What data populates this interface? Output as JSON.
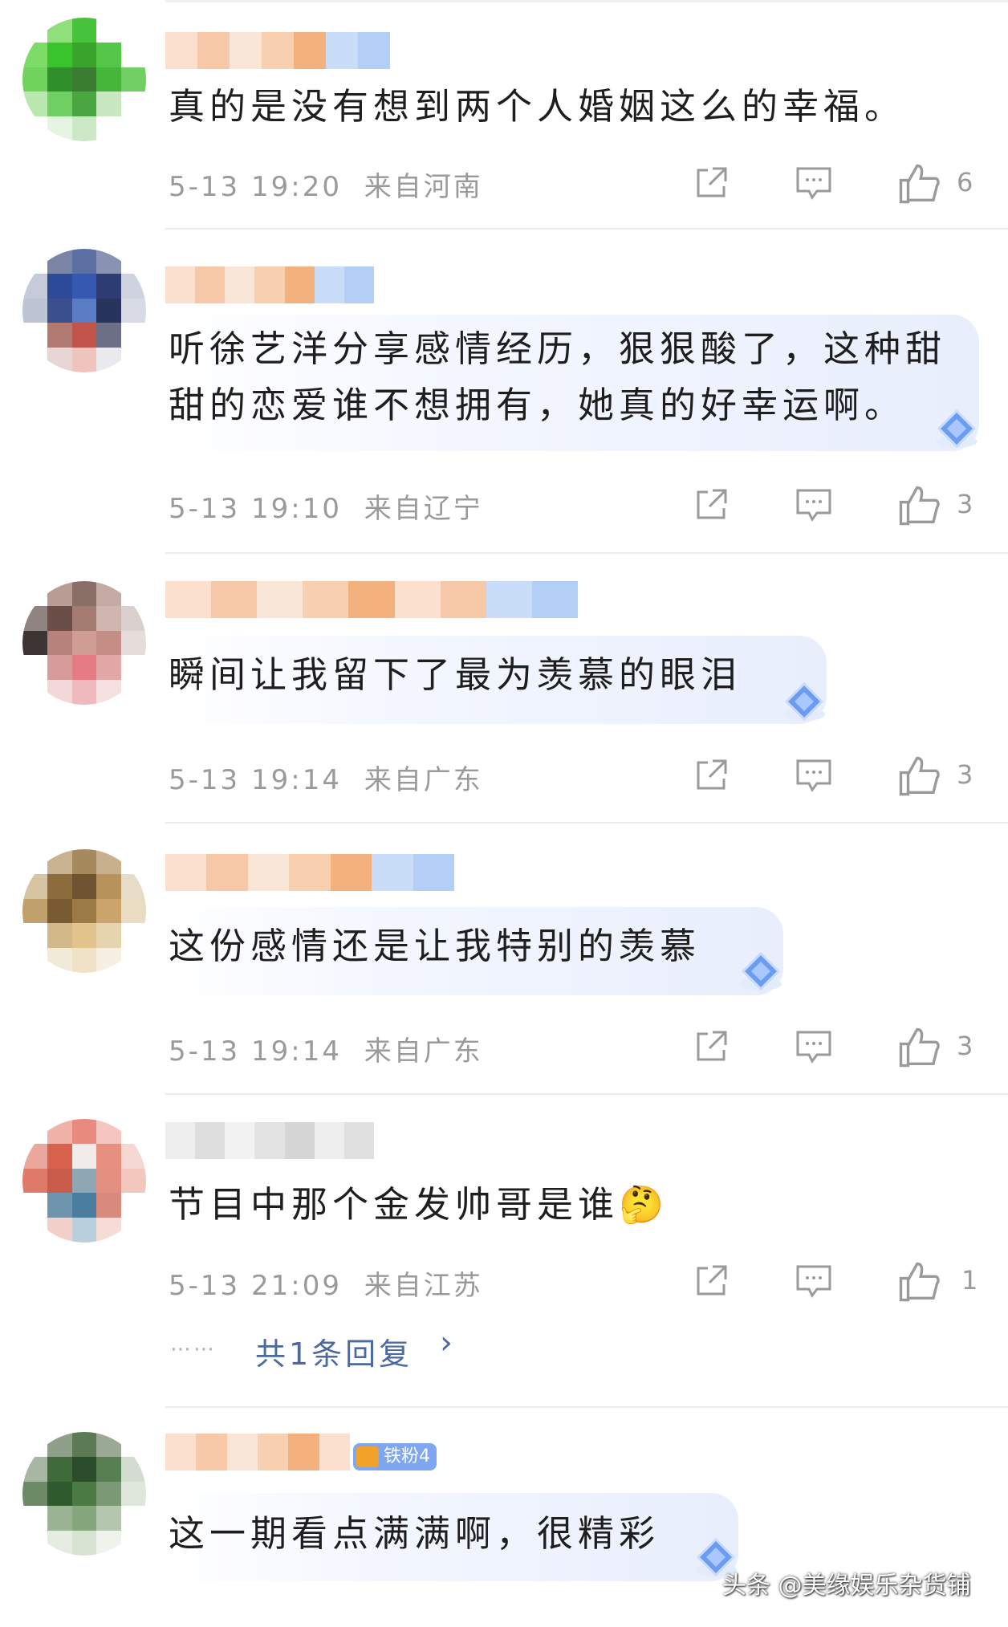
{
  "comments": [
    {
      "text": "真的是没有想到两个人婚姻这么的幸福。",
      "time": "5-13 19:20",
      "location": "来自河南",
      "likes": "6",
      "avatar_colors": [
        "#ffffff",
        "#8fe07a",
        "#47c23b",
        "#ffffff",
        "#ffffff",
        "#7ddb68",
        "#39c42c",
        "#3aa52d",
        "#54c648",
        "#ffffff",
        "#6fd35c",
        "#2f8f2a",
        "#3a7d30",
        "#46b63a",
        "#6fcf62",
        "#b8e8ae",
        "#6fcf62",
        "#4aa640",
        "#c9e8c1",
        "#ffffff",
        "#ffffff",
        "#e6f4e2",
        "#cde8c7",
        "#ffffff",
        "#ffffff"
      ],
      "name_colors": [
        "#fbe0cf",
        "#f6c8a8",
        "#fae6d6",
        "#f8d0b0",
        "#f3b17d",
        "#c9ddf8",
        "#b3cff5"
      ]
    },
    {
      "text": "听徐艺洋分享感情经历，狠狠酸了，这种甜甜的恋爱谁不想拥有，她真的好幸运啊。",
      "time": "5-13 19:10",
      "location": "来自辽宁",
      "likes": "3",
      "avatar_colors": [
        "#ffffff",
        "#7a84a6",
        "#5c6fa3",
        "#8892b3",
        "#ffffff",
        "#c7cad8",
        "#2e4a9a",
        "#3558b0",
        "#2d3d74",
        "#cfd3e0",
        "#bfc4d4",
        "#3b4f8f",
        "#5a7cc4",
        "#27345e",
        "#d8dbe6",
        "#ffffff",
        "#b07a72",
        "#c0534a",
        "#6d6f86",
        "#ffffff",
        "#ffffff",
        "#e8d6d4",
        "#efc4bf",
        "#e9e9ee",
        "#ffffff"
      ],
      "name_colors": [
        "#fbe0cf",
        "#f6c8a8",
        "#fae6d6",
        "#f8d0b0",
        "#f3b17d",
        "#c9ddf8",
        "#b3cff5"
      ]
    },
    {
      "text": "瞬间让我留下了最为羡慕的眼泪",
      "time": "5-13 19:14",
      "location": "来自广东",
      "likes": "3",
      "avatar_colors": [
        "#ffffff",
        "#b99d94",
        "#8a6f67",
        "#c3aaa3",
        "#ffffff",
        "#8f8480",
        "#6b4e47",
        "#a57c72",
        "#cfb7b0",
        "#d9cfcc",
        "#3d3533",
        "#b7827b",
        "#d09d94",
        "#c48e87",
        "#e6dcda",
        "#ffffff",
        "#d89b9b",
        "#e57c84",
        "#e3a7a5",
        "#ffffff",
        "#ffffff",
        "#f2d8d9",
        "#f0b9bd",
        "#f6e1e2",
        "#ffffff"
      ],
      "name_colors": [
        "#fbe0cf",
        "#f6c8a8",
        "#fae6d6",
        "#f8d0b0",
        "#f3b17d",
        "#fbe0cf",
        "#f6c8a8",
        "#c9ddf8",
        "#b3cff5"
      ]
    },
    {
      "text": "这份感情还是让我特别的羡慕",
      "time": "5-13 19:14",
      "location": "来自广东",
      "likes": "3",
      "avatar_colors": [
        "#ffffff",
        "#c9b28f",
        "#a58a5d",
        "#c7b08b",
        "#ffffff",
        "#d6c4a2",
        "#8c6c3d",
        "#6e5431",
        "#b7925a",
        "#e7dcc8",
        "#c0a06b",
        "#7a5a31",
        "#9c7a45",
        "#caa46a",
        "#e9dcc2",
        "#ffffff",
        "#d3b98a",
        "#e0c48c",
        "#e6d4ae",
        "#ffffff",
        "#ffffff",
        "#f2ead9",
        "#efe2c7",
        "#f6efe2",
        "#ffffff"
      ],
      "name_colors": [
        "#fbe0cf",
        "#f6c8a8",
        "#fae6d6",
        "#f8d0b0",
        "#f3b17d",
        "#c9ddf8",
        "#b3cff5"
      ]
    },
    {
      "text": "节目中那个金发帅哥是谁🤔",
      "time": "5-13 21:09",
      "location": "来自江苏",
      "likes": "1",
      "reply_dots": "⋯⋯",
      "reply_text": "共1条回复",
      "reply_arrow": "›",
      "avatar_colors": [
        "#ffffff",
        "#f0b3aa",
        "#e98a7e",
        "#f4c6bf",
        "#ffffff",
        "#eaa79c",
        "#d9624f",
        "#f1ece9",
        "#e8907f",
        "#f5d8d2",
        "#e07a68",
        "#c85b49",
        "#8fa6b3",
        "#e38f7f",
        "#f2c7be",
        "#ffffff",
        "#6e95ad",
        "#4a7d9e",
        "#d88b7c",
        "#ffffff",
        "#ffffff",
        "#f3d0c9",
        "#b9cfdc",
        "#f6dcd6",
        "#ffffff"
      ],
      "name_colors": [
        "#eeeeee",
        "#dddddd",
        "#f2f2f2",
        "#e3e3e3",
        "#d6d6d6",
        "#eeeeee",
        "#e0e0e0"
      ]
    },
    {
      "text": "这一期看点满满啊，很精彩",
      "time": "",
      "location": "",
      "likes": "",
      "badge": "铁粉4",
      "avatar_colors": [
        "#ffffff",
        "#8fa08a",
        "#5d7a57",
        "#9aaa95",
        "#ffffff",
        "#a7b7a2",
        "#3f6a3a",
        "#2c4d2b",
        "#587f52",
        "#d2dccf",
        "#6d8a66",
        "#2f5a2d",
        "#4c7a44",
        "#7b9974",
        "#dfe6dc",
        "#ffffff",
        "#9ab493",
        "#86a77e",
        "#b4c7ae",
        "#ffffff",
        "#ffffff",
        "#e5ece2",
        "#d7e3d3",
        "#eef3ec",
        "#ffffff"
      ],
      "name_colors": [
        "#fbe0cf",
        "#f6c8a8",
        "#fae6d6",
        "#f8d0b0",
        "#f3b17d",
        "#fbe0cf"
      ]
    }
  ],
  "icons": {
    "share": "share-icon",
    "comment": "comment-icon",
    "like": "thumbs-up-icon"
  },
  "watermark": "头条 @美缘娱乐杂货铺"
}
